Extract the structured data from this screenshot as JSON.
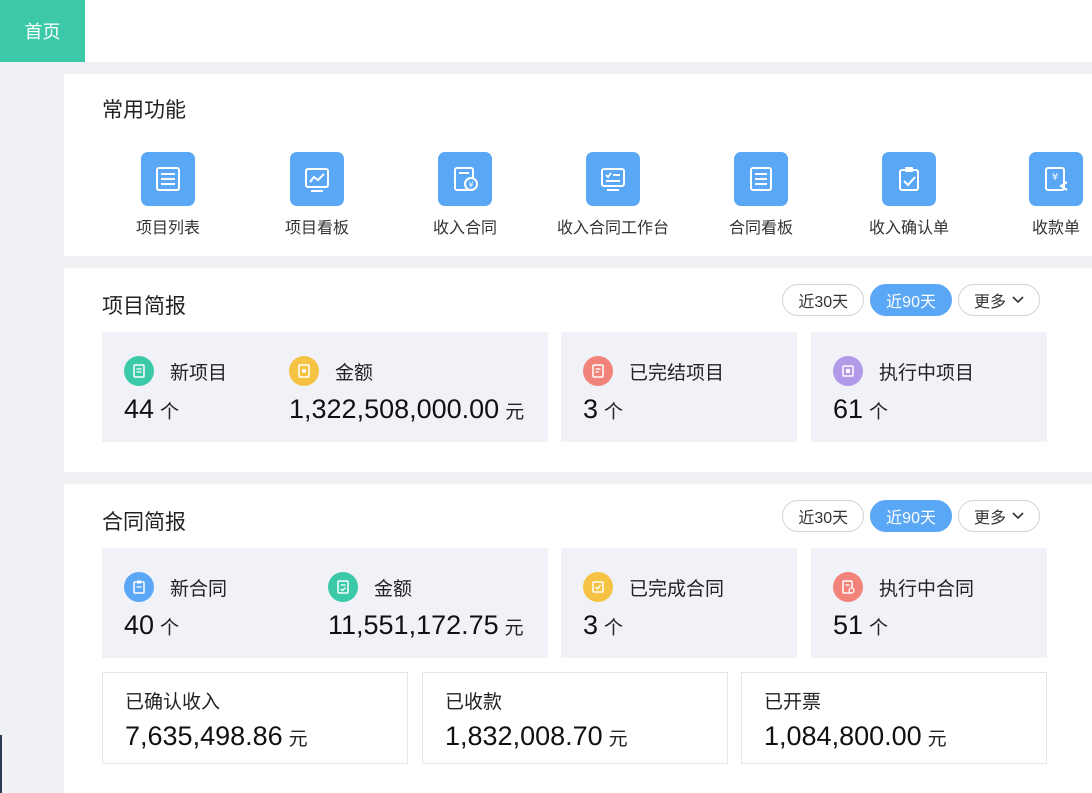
{
  "nav": {
    "home_tab": "首页"
  },
  "common": {
    "title": "常用功能",
    "items": [
      {
        "label": "项目列表",
        "icon": "list-icon"
      },
      {
        "label": "项目看板",
        "icon": "chart-board-icon"
      },
      {
        "label": "收入合同",
        "icon": "contract-coin-icon"
      },
      {
        "label": "收入合同工作台",
        "icon": "checklist-icon"
      },
      {
        "label": "合同看板",
        "icon": "document-lines-icon"
      },
      {
        "label": "收入确认单",
        "icon": "clipboard-check-icon"
      },
      {
        "label": "收款单",
        "icon": "yen-receipt-icon"
      }
    ]
  },
  "project": {
    "title": "项目简报",
    "filters": {
      "d30": "近30天",
      "d90": "近90天",
      "more": "更多"
    },
    "new_label": "新项目",
    "new_value": "44",
    "new_unit": "个",
    "amount_label": "金额",
    "amount_value": "1,322,508,000.00",
    "amount_unit": "元",
    "done_label": "已完结项目",
    "done_value": "3",
    "done_unit": "个",
    "running_label": "执行中项目",
    "running_value": "61",
    "running_unit": "个"
  },
  "contract": {
    "title": "合同简报",
    "filters": {
      "d30": "近30天",
      "d90": "近90天",
      "more": "更多"
    },
    "new_label": "新合同",
    "new_value": "40",
    "new_unit": "个",
    "amount_label": "金额",
    "amount_value": "11,551,172.75",
    "amount_unit": "元",
    "done_label": "已完成合同",
    "done_value": "3",
    "done_unit": "个",
    "running_label": "执行中合同",
    "running_value": "51",
    "running_unit": "个",
    "confirmed_label": "已确认收入",
    "confirmed_value": "7,635,498.86",
    "confirmed_unit": "元",
    "received_label": "已收款",
    "received_value": "1,832,008.70",
    "received_unit": "元",
    "invoiced_label": "已开票",
    "invoiced_value": "1,084,800.00",
    "invoiced_unit": "元"
  },
  "colors": {
    "accent": "#5aa7f5",
    "home": "#3cc9a8",
    "green": "#3cc9a8",
    "yellow": "#f5c243",
    "red": "#f2837a",
    "purple": "#b39ae8",
    "blue": "#5aa7f5"
  }
}
